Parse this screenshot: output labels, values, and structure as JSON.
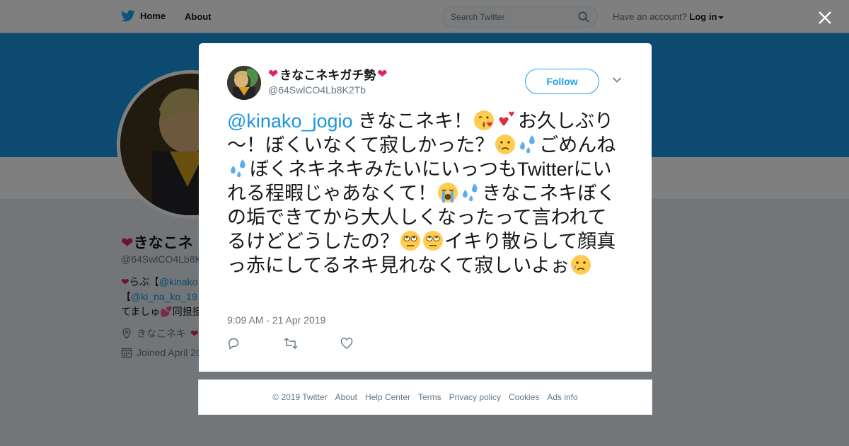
{
  "nav": {
    "home_label": "Home",
    "about_label": "About",
    "search_placeholder": "Search Twitter",
    "account_prompt": "Have an account?",
    "login_label": "Log in"
  },
  "background_profile": {
    "name_fragment": "きなこネ",
    "handle_fragment": "@64SwlCO4Lb8K",
    "bio_line1_prefix": "らぶ【",
    "bio_line1_link": "@kinako",
    "bio_line2_prefix": "【",
    "bio_line2_link": "@ki_na_ko_19",
    "bio_line3_prefix": "てましゅ",
    "bio_line3_suffix": "同担担",
    "location": "きなこネキ",
    "joined": "Joined April 20"
  },
  "tweet": {
    "display_name": "きなこネキガチ勢",
    "handle": "@64SwlCO4Lb8K2Tb",
    "follow_label": "Follow",
    "mention": "@kinako_jogio",
    "text_1": " きなこネキ！",
    "text_2": "お久しぶり～！ぼくいなくて寂しかった？",
    "text_3": "ごめんね",
    "text_4": "ぼくネキネキみたいにいっつもTwitterにいれる程暇じゃあなくて！",
    "text_5": "きなこネキぼくの垢できてから大人しくなったって言われてるけどどうしたの？",
    "text_6": "イキり散らして顔真っ赤にしてるネキ見れなくて寂しいよぉ",
    "timestamp": "9:09 AM - 21 Apr 2019"
  },
  "footer": {
    "links": [
      "© 2019 Twitter",
      "About",
      "Help Center",
      "Terms",
      "Privacy policy",
      "Cookies",
      "Ads info"
    ]
  },
  "colors": {
    "brand_blue": "#1da1f2",
    "link_blue": "#1b95e0",
    "banner": "#1b95e0",
    "heart_red": "#e0245e"
  },
  "icons": [
    "twitter-bird-icon",
    "search-icon",
    "close-icon",
    "chevron-down-icon",
    "reply-icon",
    "retweet-icon",
    "like-icon",
    "location-icon",
    "calendar-icon"
  ]
}
